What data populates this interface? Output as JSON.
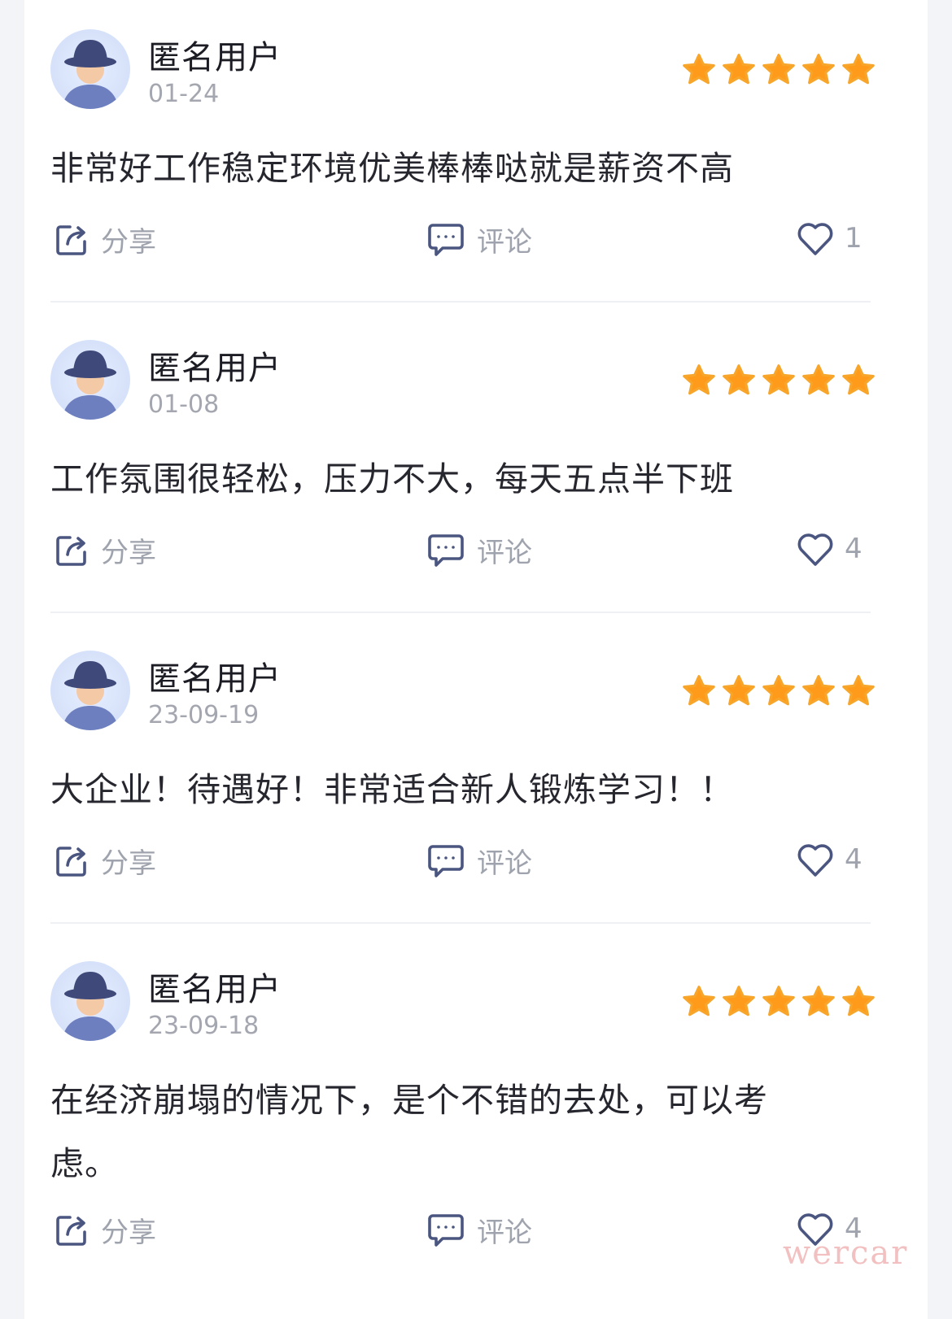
{
  "reviews": [
    {
      "user": "匿名用户",
      "date": "01-24",
      "rating": 5,
      "content": "非常好工作稳定环境优美棒棒哒就是薪资不高",
      "share_label": "分享",
      "comment_label": "评论",
      "likes": "1"
    },
    {
      "user": "匿名用户",
      "date": "01-08",
      "rating": 5,
      "content": "工作氛围很轻松，压力不大，每天五点半下班",
      "share_label": "分享",
      "comment_label": "评论",
      "likes": "4"
    },
    {
      "user": "匿名用户",
      "date": "23-09-19",
      "rating": 5,
      "content": "大企业！待遇好！非常适合新人锻炼学习！！",
      "share_label": "分享",
      "comment_label": "评论",
      "likes": "4"
    },
    {
      "user": "匿名用户",
      "date": "23-09-18",
      "rating": 5,
      "content": "在经济崩塌的情况下，是个不错的去处，可以考虑。",
      "share_label": "分享",
      "comment_label": "评论",
      "likes": "4"
    }
  ],
  "watermark": "wercar",
  "colors": {
    "star": "#ff9a1a",
    "icon": "#4b5680",
    "meta_text": "#a4a6b0",
    "body_text": "#26262e"
  },
  "icons": {
    "share": "share-icon",
    "comment": "comment-icon",
    "like": "heart-icon",
    "star": "star-icon",
    "avatar": "anonymous-avatar"
  }
}
